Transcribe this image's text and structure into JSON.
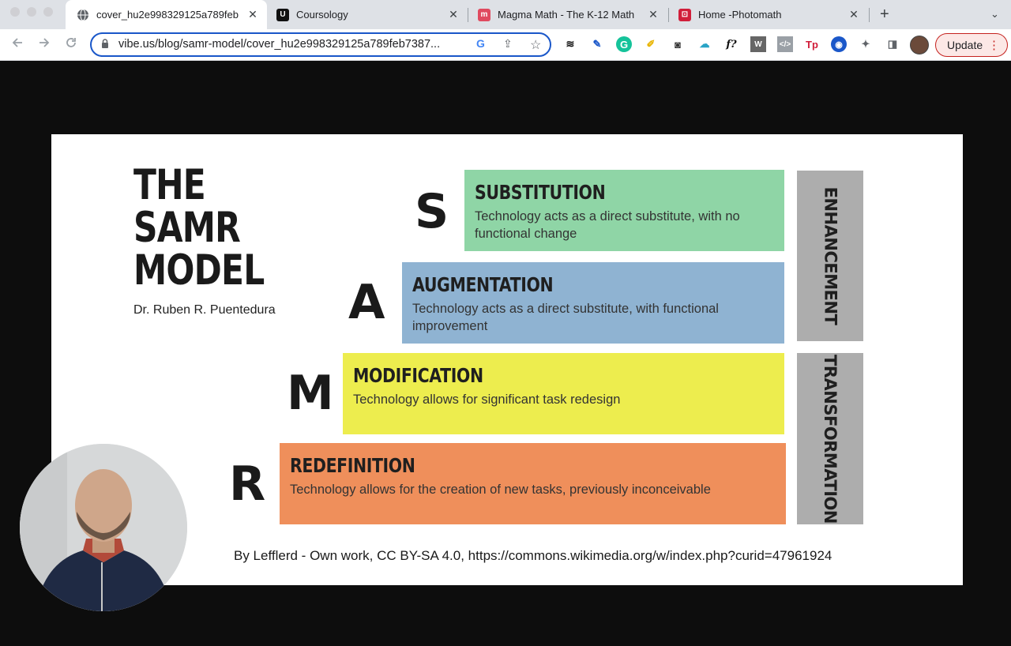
{
  "browser": {
    "tabs": [
      {
        "title": "cover_hu2e998329125a789feb",
        "favicon": "globe-icon",
        "active": true
      },
      {
        "title": "Coursology",
        "favicon": "coursology-icon",
        "active": false
      },
      {
        "title": "Magma Math - The K-12 Math",
        "favicon": "magma-math-icon",
        "active": false
      },
      {
        "title": "Home -Photomath",
        "favicon": "photomath-icon",
        "active": false
      }
    ],
    "tab_close": "✕",
    "new_tab": "+",
    "tab_search": "⌄",
    "url": "vibe.us/blog/samr-model/cover_hu2e998329125a789feb7387...",
    "update_label": "Update",
    "colors": {
      "accent": "#1a57c9",
      "update_border": "#c5221f",
      "tab_strip": "#dee1e6"
    }
  },
  "slide": {
    "title_lines": [
      "THE",
      "SAMR",
      "MODEL"
    ],
    "author": "Dr. Ruben R. Puentedura",
    "levels": [
      {
        "letter": "S",
        "heading": "SUBSTITUTION",
        "description": "Technology acts as a direct substitute, with no functional change",
        "color": "#8fd5a6"
      },
      {
        "letter": "A",
        "heading": "AUGMENTATION",
        "description": "Technology acts as a direct substitute, with functional improvement",
        "color": "#8fb3d2"
      },
      {
        "letter": "M",
        "heading": "MODIFICATION",
        "description": "Technology allows for significant task redesign",
        "color": "#eded4e"
      },
      {
        "letter": "R",
        "heading": "REDEFINITION",
        "description": "Technology allows for the creation of new tasks, previously inconceivable",
        "color": "#ef8f5b"
      }
    ],
    "groups": [
      "ENHANCEMENT",
      "TRANSFORMATION"
    ],
    "credit": "By Lefflerd - Own work, CC BY-SA 4.0, https://commons.wikimedia.org/w/index.php?curid=47961924"
  }
}
